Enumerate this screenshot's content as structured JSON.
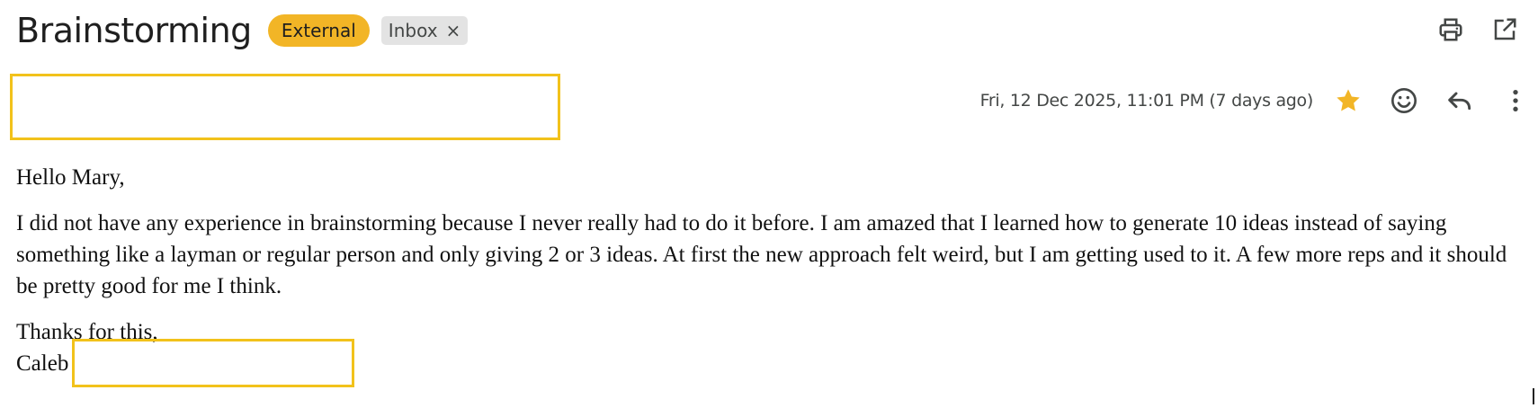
{
  "email": {
    "subject": "Brainstorming",
    "labels": {
      "external": "External",
      "inbox": "Inbox",
      "inbox_remove": "×"
    },
    "date": "Fri, 12 Dec 2025, 11:01 PM (7 days ago)",
    "body": {
      "greeting": "Hello Mary,",
      "paragraph": "I did not have any experience in brainstorming because I never really had to do it before. I am amazed that I learned how to generate 10 ideas instead of saying something like a layman or regular person and only giving 2 or 3 ideas. At first the new approach felt weird, but I am getting used to it. A few more reps and it should be pretty good for me I think.",
      "closing": "Thanks for this,",
      "signature": "Caleb"
    }
  },
  "icons": {
    "print": "print-icon",
    "open_new_window": "open-in-new-window-icon",
    "star": "star-icon",
    "emoji": "emoji-icon",
    "reply": "reply-icon",
    "more": "more-vert-icon"
  },
  "colors": {
    "external_badge": "#f2b526",
    "inbox_badge": "#e3e3e3",
    "star": "#f2b526",
    "highlight_box": "#f2c21b"
  }
}
